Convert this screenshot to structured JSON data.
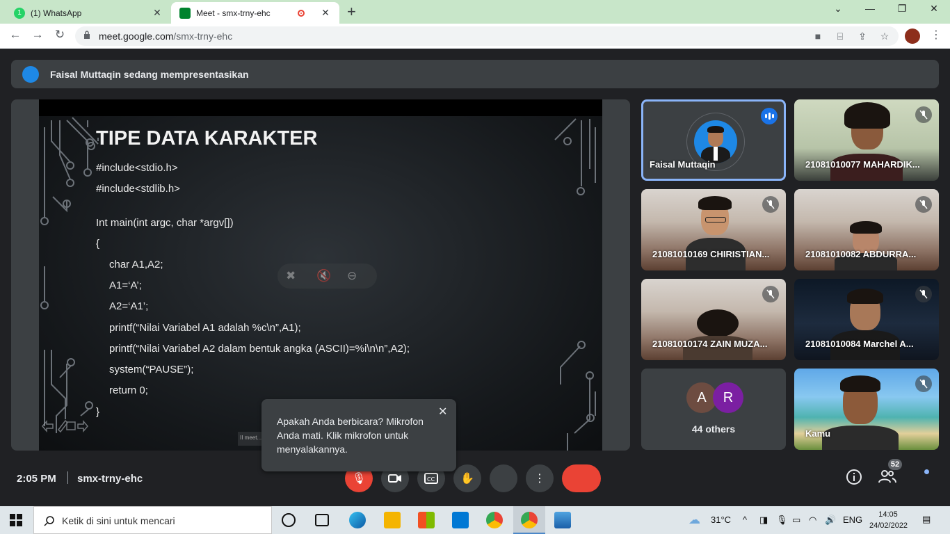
{
  "browser": {
    "tabs": [
      {
        "title": "(1) WhatsApp",
        "badge": "1",
        "active": false
      },
      {
        "title": "Meet - smx-trny-ehc",
        "active": true
      }
    ],
    "url_host": "meet.google.com",
    "url_path": "/smx-trny-ehc"
  },
  "banner": {
    "text": "Faisal Muttaqin sedang mempresentasikan"
  },
  "slide": {
    "title": "TIPE DATA KARAKTER",
    "code_lines": [
      "#include<stdio.h>",
      "#include<stdlib.h>",
      "Int main(int argc, char *argv[])",
      "{",
      "char A1,A2;",
      "A1=‘A’;",
      "A2=‘A1’;",
      "printf(“Nilai Variabel A1 adalah %c\\n”,A1);",
      "printf(“Nilai Variabel A2 dalam bentuk angka (ASCII)=%i\\n\\n”,A2);",
      "system(“PAUSE”);",
      "return 0;",
      "}"
    ],
    "mini_tag": "II meet..."
  },
  "participants": [
    {
      "name": "Faisal Muttaqin",
      "speaking": true
    },
    {
      "name": "21081010077 MAHARDIK...",
      "muted": true
    },
    {
      "name": "21081010169 CHIRISTIAN...",
      "muted": true
    },
    {
      "name": "21081010082 ABDURRA...",
      "muted": true
    },
    {
      "name": "21081010174 ZAIN MUZA...",
      "muted": true
    },
    {
      "name": "21081010084 Marchel A...",
      "muted": true
    },
    {
      "name": "Kamu",
      "muted": true
    }
  ],
  "others": {
    "avatars": [
      {
        "letter": "A",
        "color": "#6d4c41"
      },
      {
        "letter": "R",
        "color": "#7b1fa2"
      }
    ],
    "label": "44 others"
  },
  "bottom_bar": {
    "time": "2:05 PM",
    "meeting_code": "smx-trny-ehc",
    "people_count": "52"
  },
  "toast": {
    "message": "Apakah Anda berbicara? Mikrofon Anda mati. Klik mikrofon untuk menyalakannya."
  },
  "taskbar": {
    "search_placeholder": "Ketik di sini untuk mencari",
    "weather": "31°C",
    "language": "ENG",
    "time": "14:05",
    "date": "24/02/2022"
  },
  "colors": {
    "accent_blue": "#8ab4f8",
    "end_call_red": "#ea4335",
    "tab_strip": "#c8e6c9"
  }
}
